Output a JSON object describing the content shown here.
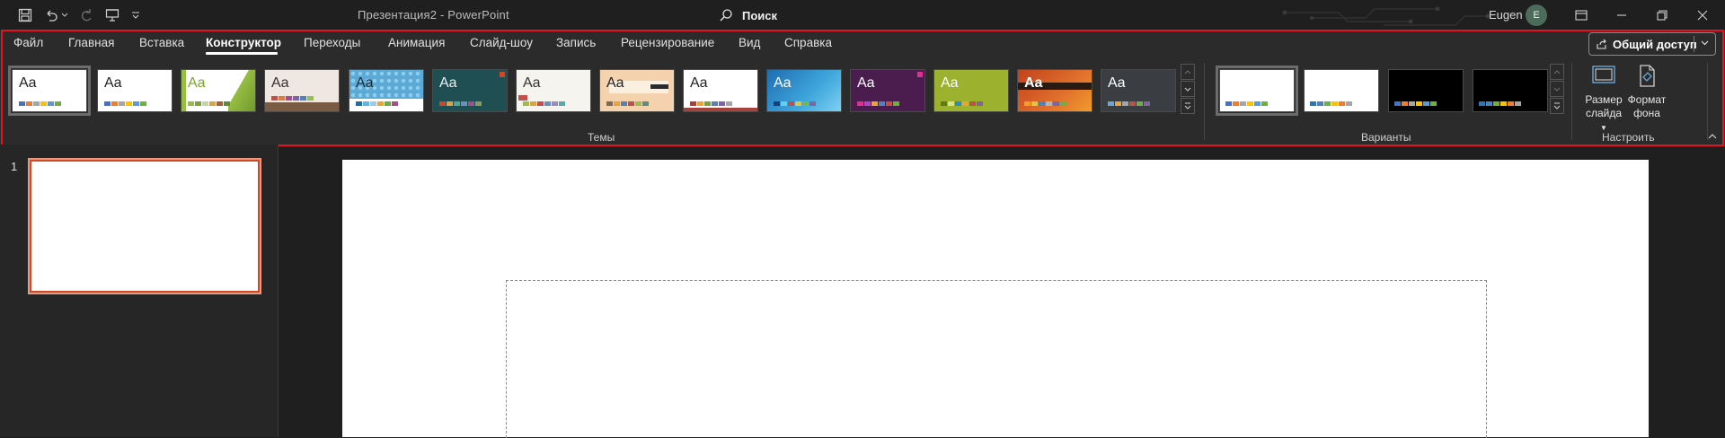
{
  "window": {
    "title": "Презентация2  -  PowerPoint",
    "search_label": "Поиск",
    "user_name": "Eugen",
    "user_initial": "E"
  },
  "tabs": [
    {
      "label": "Файл",
      "active": false
    },
    {
      "label": "Главная",
      "active": false
    },
    {
      "label": "Вставка",
      "active": false
    },
    {
      "label": "Конструктор",
      "active": true
    },
    {
      "label": "Переходы",
      "active": false
    },
    {
      "label": "Анимация",
      "active": false
    },
    {
      "label": "Слайд-шоу",
      "active": false
    },
    {
      "label": "Запись",
      "active": false
    },
    {
      "label": "Рецензирование",
      "active": false
    },
    {
      "label": "Вид",
      "active": false
    },
    {
      "label": "Справка",
      "active": false
    }
  ],
  "share_label": "Общий доступ",
  "themes_group": {
    "label": "Темы",
    "items": [
      {
        "aa": "Aa",
        "bg": "#ffffff",
        "fg": "#222222",
        "sw": [
          "#4472c4",
          "#ed7d31",
          "#a5a5a5",
          "#ffc000",
          "#5b9bd5",
          "#70ad47"
        ]
      },
      {
        "aa": "Aa",
        "bg": "#ffffff",
        "fg": "#222222",
        "sw": [
          "#4472c4",
          "#ed7d31",
          "#a5a5a5",
          "#ffc000",
          "#5b9bd5",
          "#70ad47"
        ]
      },
      {
        "aa": "Aa",
        "bg": "#ffffff",
        "fg": "#7aa436",
        "sw": [
          "#97bd42",
          "#7aa436",
          "#c3d69b",
          "#e0a33b",
          "#b05d2d",
          "#5f8a3a"
        ]
      },
      {
        "aa": "Aa",
        "bg": "#efe7e2",
        "fg": "#333333",
        "sw": [
          "#c0504d",
          "#d67f3c",
          "#a04e8f",
          "#8064a2",
          "#4f81bd",
          "#9bbb59"
        ]
      },
      {
        "aa": "Aa",
        "bg": "#5aa9d6",
        "fg": "#1b2b3a",
        "sw": [
          "#1e6fa8",
          "#5fb6e0",
          "#9bcbe8",
          "#e9a33b",
          "#6aab4f",
          "#a24f8c"
        ]
      },
      {
        "aa": "Aa",
        "bg": "#1f4f52",
        "fg": "#e8f0f0",
        "sw": [
          "#d24726",
          "#e2a23b",
          "#54a39b",
          "#6a8fc1",
          "#a34e8c",
          "#8a9a5b"
        ]
      },
      {
        "aa": "Aa",
        "bg": "#f5f4ee",
        "fg": "#333333",
        "sw": [
          "#a2b84a",
          "#e0a33b",
          "#c0504d",
          "#6a8fc1",
          "#9c8db8",
          "#5aa9a8"
        ]
      },
      {
        "aa": "Aa",
        "bg": "#f3d2ad",
        "fg": "#222222",
        "sw": [
          "#7b6a58",
          "#e9a33b",
          "#4f81bd",
          "#c0504d",
          "#9bbb59",
          "#5a8e8a"
        ]
      },
      {
        "aa": "Aa",
        "bg": "#ffffff",
        "fg": "#222222",
        "sw": [
          "#a7423a",
          "#e9a33b",
          "#7e9c4a",
          "#5b7fb0",
          "#8064a2",
          "#a5a5a5"
        ]
      },
      {
        "aa": "Aa",
        "bg": "#2a8bc8",
        "fg": "#ffffff",
        "sw": [
          "#1a3e7a",
          "#5fd0f0",
          "#c0504d",
          "#e9c23b",
          "#7ab548",
          "#8064a2"
        ]
      },
      {
        "aa": "Aa",
        "bg": "#4b1d4f",
        "fg": "#ffffff",
        "sw": [
          "#e0308d",
          "#a848c2",
          "#e9a33b",
          "#4f81bd",
          "#c0504d",
          "#70ad47"
        ]
      },
      {
        "aa": "Aa",
        "bg": "#9cb22e",
        "fg": "#ffffff",
        "sw": [
          "#5f7a18",
          "#d6e38a",
          "#2a8bc8",
          "#e9a33b",
          "#c0504d",
          "#8064a2"
        ]
      },
      {
        "aa": "Aa",
        "bg": "#c3421c",
        "fg": "#ffffff",
        "sw": [
          "#f29b2c",
          "#e9c23b",
          "#4f81bd",
          "#b3b3b3",
          "#8064a2",
          "#70ad47"
        ]
      },
      {
        "aa": "Aa",
        "bg": "#3a3d42",
        "fg": "#ffffff",
        "sw": [
          "#6aa6d8",
          "#e9a33b",
          "#a5a5a5",
          "#c0504d",
          "#70ad47",
          "#8064a2"
        ]
      }
    ]
  },
  "variants_group": {
    "label": "Варианты",
    "items": [
      {
        "bg": "#ffffff",
        "sw": [
          "#4472c4",
          "#ed7d31",
          "#a5a5a5",
          "#ffc000",
          "#5b9bd5",
          "#70ad47"
        ]
      },
      {
        "bg": "#ffffff",
        "sw": [
          "#2e75b6",
          "#4f81bd",
          "#70ad47",
          "#ffc000",
          "#ed7d31",
          "#a5a5a5"
        ]
      },
      {
        "bg": "#000000",
        "sw": [
          "#4472c4",
          "#ed7d31",
          "#a5a5a5",
          "#ffc000",
          "#5b9bd5",
          "#70ad47"
        ]
      },
      {
        "bg": "#000000",
        "sw": [
          "#2e75b6",
          "#4f81bd",
          "#70ad47",
          "#ffc000",
          "#ed7d31",
          "#a5a5a5"
        ]
      }
    ]
  },
  "customize_group": {
    "label": "Настроить",
    "slide_size_label_1": "Размер",
    "slide_size_label_2": "слайда",
    "format_bg_label_1": "Формат",
    "format_bg_label_2": "фона"
  },
  "slides": [
    {
      "number": "1"
    }
  ]
}
